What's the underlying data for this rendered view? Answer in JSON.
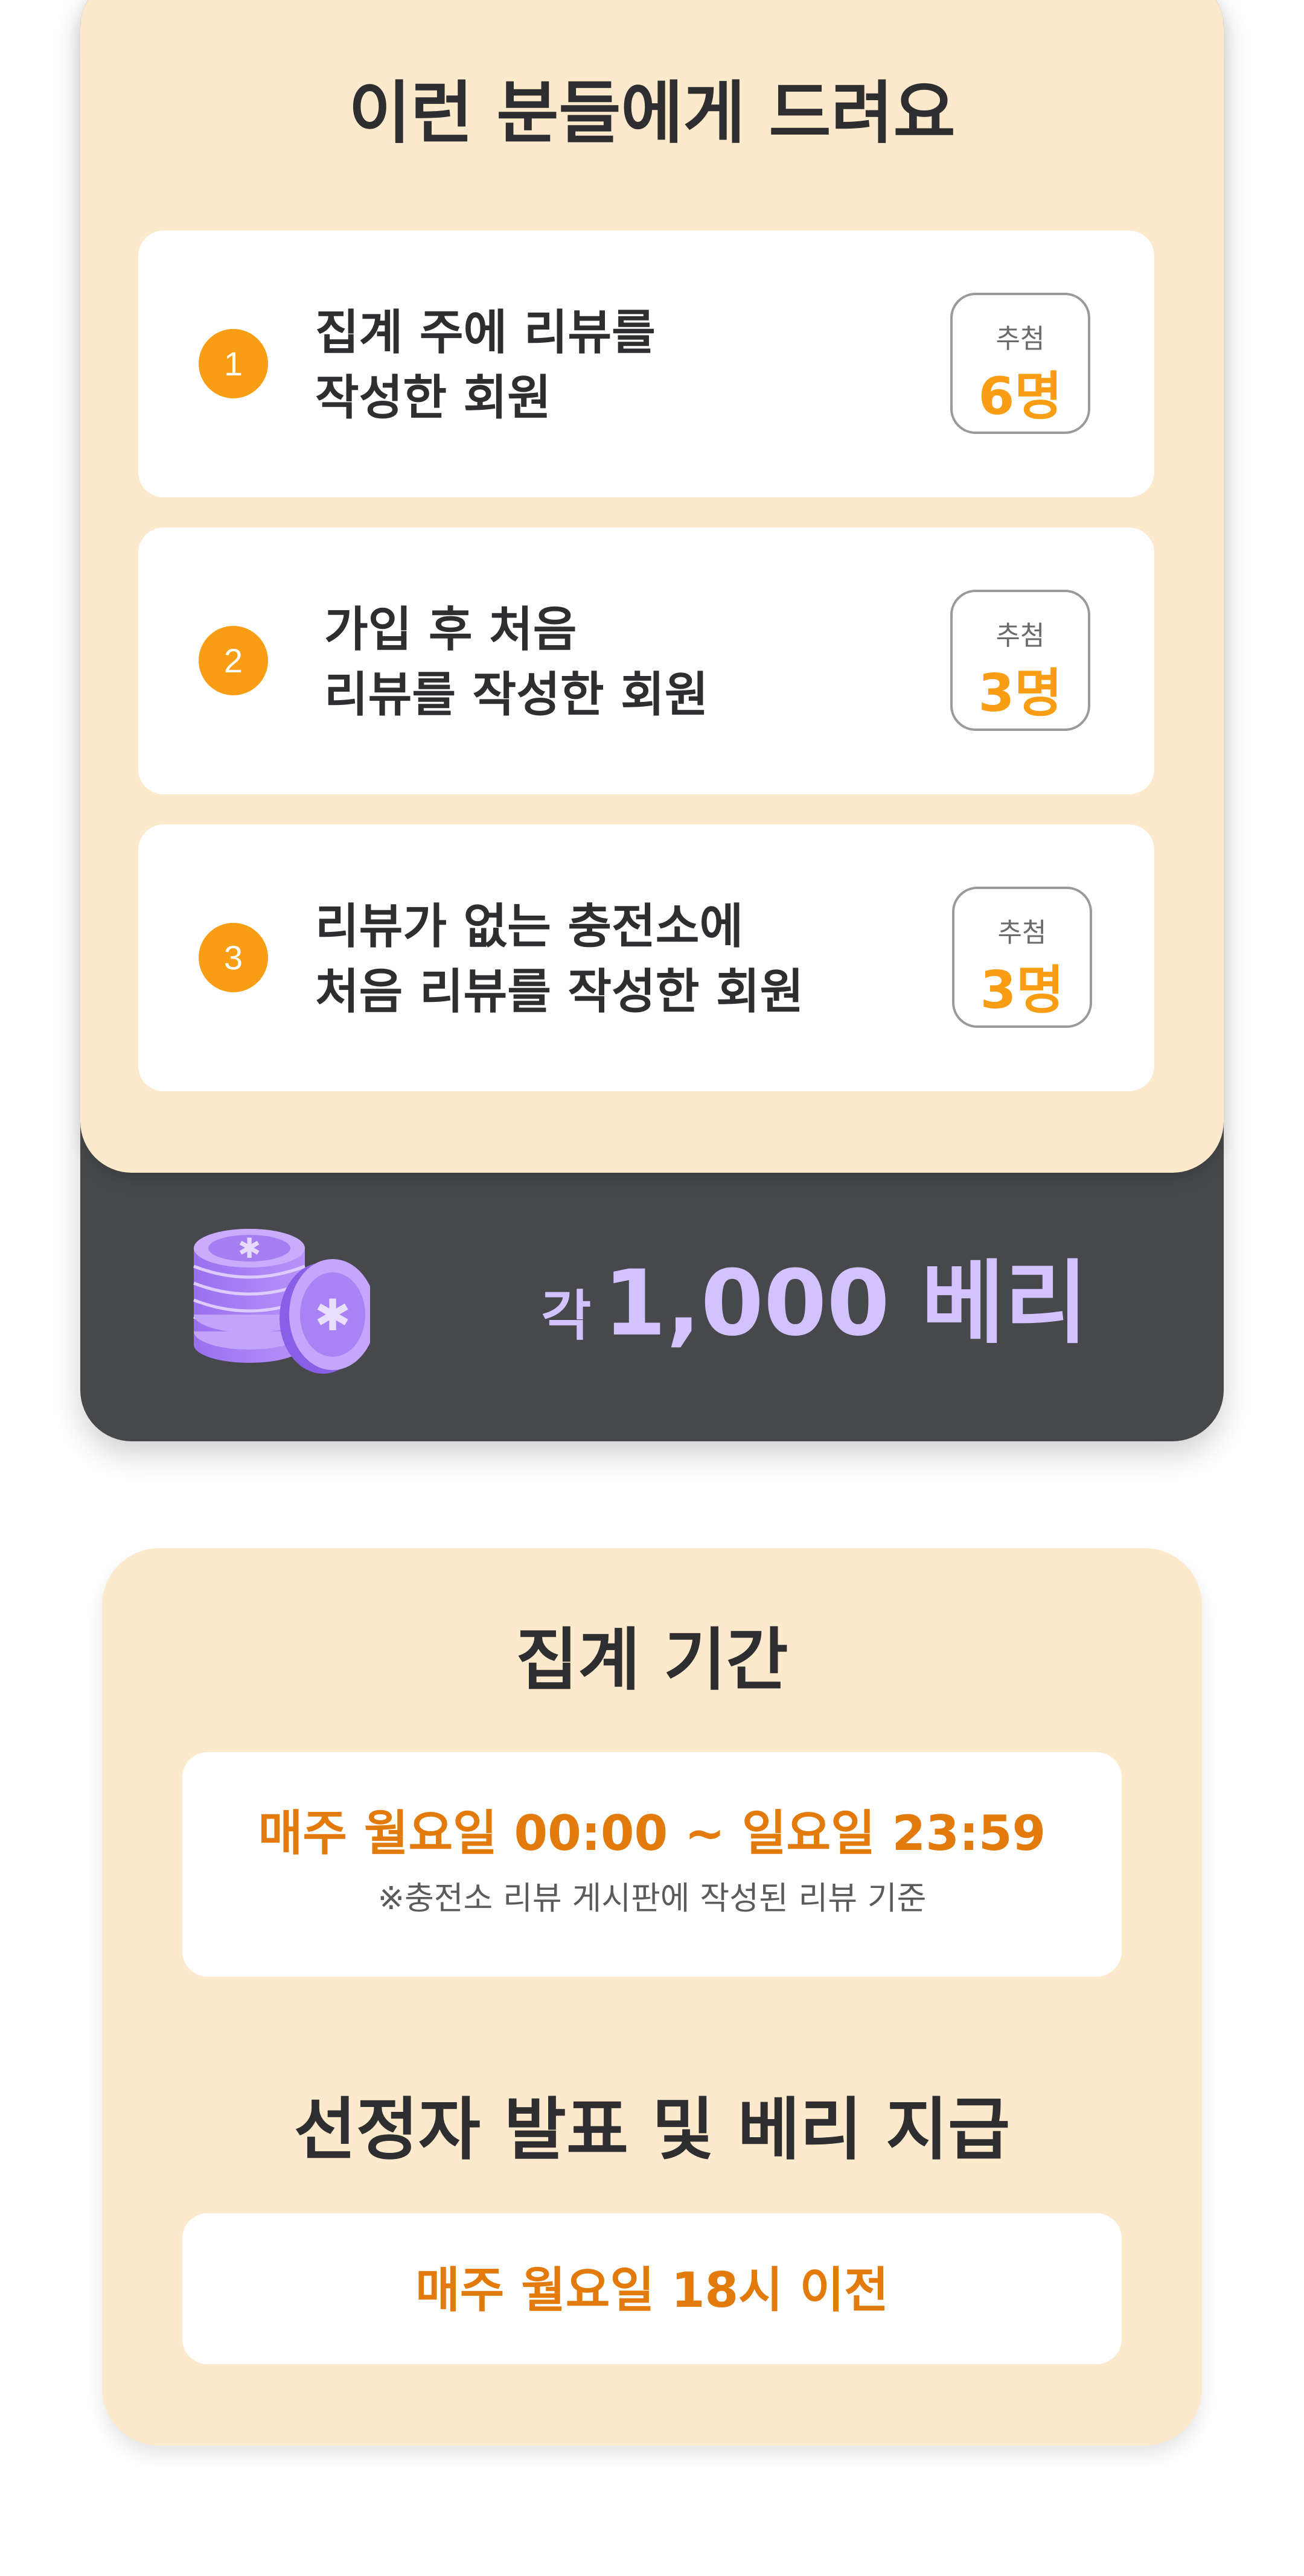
{
  "reward_section": {
    "title": "이런 분들에게 드려요",
    "conditions": [
      {
        "number": "1",
        "text": "집계 주에 리뷰를\n작성한 회원",
        "count_label": "추첨",
        "count": "6명"
      },
      {
        "number": "2",
        "text": "가입 후 처음\n리뷰를 작성한 회원",
        "count_label": "추첨",
        "count": "3명"
      },
      {
        "number": "3",
        "text": "리뷰가 없는 충전소에\n처음 리뷰를 작성한 회원",
        "count_label": "추첨",
        "count": "3명"
      }
    ],
    "reward_prefix": "각",
    "reward_value": "1,000 베리",
    "coin_icon": "coin-stack-icon"
  },
  "schedule_section": {
    "period_title": "집계 기간",
    "period_text": "매주 월요일 00:00 ~ 일요일 23:59",
    "period_note": "※충전소 리뷰 게시판에 작성된 리뷰 기준",
    "announce_title": "선정자 발표 및 베리 지급",
    "announce_text": "매주 월요일 18시 이전"
  },
  "colors": {
    "cream": "#fde9cc",
    "dark": "#46484c",
    "accent_orange": "#f99e14",
    "text_orange": "#e37a0c",
    "reward_lavender": "#d2c2ff",
    "coin_purple": "#a97ef0"
  }
}
